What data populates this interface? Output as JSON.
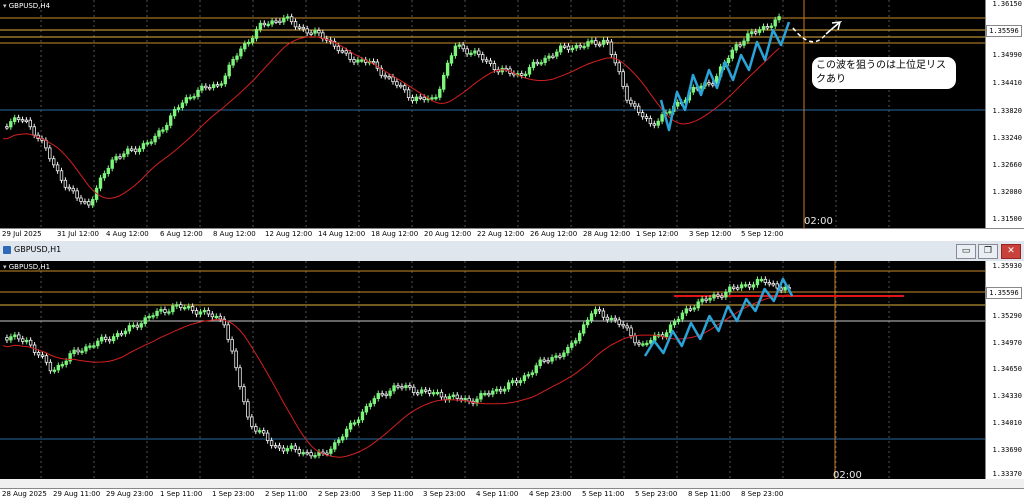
{
  "top_chart": {
    "symbol": "GBPUSD,H4",
    "price_labels": [
      "1.36150",
      "1.35596",
      "1.34990",
      "1.34410",
      "1.33820",
      "1.33240",
      "1.32660",
      "1.32080",
      "1.31500"
    ],
    "current_price": "1.35596",
    "time_labels": [
      "29 Jul 2025",
      "31 Jul 12:00",
      "4 Aug 12:00",
      "6 Aug 12:00",
      "8 Aug 12:00",
      "12 Aug 12:00",
      "14 Aug 12:00",
      "18 Aug 12:00",
      "20 Aug 12:00",
      "22 Aug 12:00",
      "26 Aug 12:00",
      "28 Aug 12:00",
      "1 Sep 12:00",
      "3 Sep 12:00",
      "5 Sep 12:00"
    ],
    "cursor_time": "02:00",
    "annotation": "この波を狙うのは上位足リスクあり"
  },
  "bottom_window": {
    "title": "GBPUSD,H1",
    "buttons": {
      "minimize": "▭",
      "restore": "❐",
      "close": "✕"
    }
  },
  "bottom_chart": {
    "symbol": "GBPUSD,H1",
    "price_labels": [
      "1.35930",
      "1.35596",
      "1.35290",
      "1.34970",
      "1.34650",
      "1.34330",
      "1.34010",
      "1.33690",
      "1.33370"
    ],
    "current_price": "1.35596",
    "time_labels": [
      "28 Aug 2025",
      "29 Aug 11:00",
      "29 Aug 23:00",
      "1 Sep 11:00",
      "1 Sep 23:00",
      "2 Sep 11:00",
      "2 Sep 23:00",
      "3 Sep 11:00",
      "3 Sep 23:00",
      "4 Sep 11:00",
      "4 Sep 23:00",
      "5 Sep 11:00",
      "5 Sep 23:00",
      "8 Sep 11:00",
      "8 Sep 23:00"
    ],
    "cursor_time": "02:00"
  },
  "colors": {
    "bull": "#7df57d",
    "bear": "#f2f2f2",
    "ma": "#d42020",
    "wave": "#2aa4d8",
    "hline_orange": "#c88a2a",
    "hline_gold": "#e0b040",
    "hline_blue": "#2c6aa0",
    "redline": "#e01515",
    "cursor": "#c87a20"
  }
}
